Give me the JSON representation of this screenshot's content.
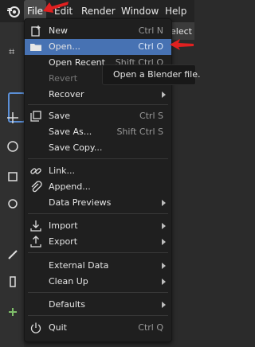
{
  "menubar": {
    "file": "File",
    "edit": "Edit",
    "render": "Render",
    "window": "Window",
    "help": "Help"
  },
  "header": {
    "select_text": "elect"
  },
  "file_menu": {
    "new": {
      "label": "New",
      "shortcut": "Ctrl N"
    },
    "open": {
      "label": "Open...",
      "shortcut": "Ctrl O"
    },
    "open_recent": {
      "label": "Open Recent",
      "shortcut": "Shift Ctrl O"
    },
    "revert": {
      "label": "Revert"
    },
    "recover": {
      "label": "Recover"
    },
    "save": {
      "label": "Save",
      "shortcut": "Ctrl S"
    },
    "save_as": {
      "label": "Save As...",
      "shortcut": "Shift Ctrl S"
    },
    "save_copy": {
      "label": "Save Copy..."
    },
    "link": {
      "label": "Link..."
    },
    "append": {
      "label": "Append..."
    },
    "data_previews": {
      "label": "Data Previews"
    },
    "import": {
      "label": "Import"
    },
    "export": {
      "label": "Export"
    },
    "external_data": {
      "label": "External Data"
    },
    "clean_up": {
      "label": "Clean Up"
    },
    "defaults": {
      "label": "Defaults"
    },
    "quit": {
      "label": "Quit",
      "shortcut": "Ctrl Q"
    }
  },
  "tooltip": {
    "text": "Open a Blender file."
  },
  "colors": {
    "highlight": "#4772b3",
    "annotation_arrow": "#e02020",
    "menu_bg": "#1f1f1f"
  },
  "icons": [
    "blender-logo-icon",
    "new-file-icon",
    "folder-icon",
    "save-icon",
    "link-icon",
    "paperclip-icon",
    "import-icon",
    "export-icon",
    "power-icon"
  ]
}
